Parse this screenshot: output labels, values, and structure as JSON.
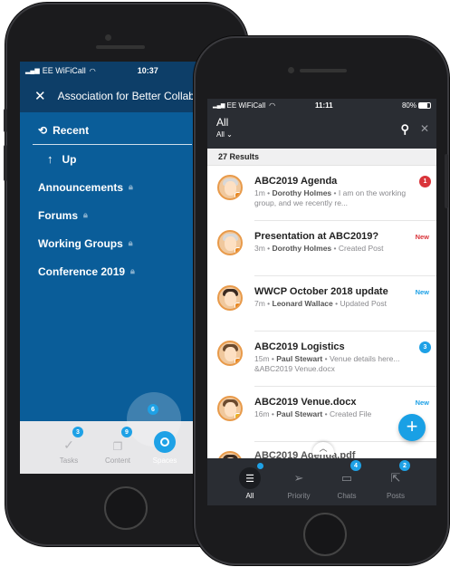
{
  "colors": {
    "accent": "#1ea1e6",
    "back_screen_bg": "#0a5d99",
    "front_header_bg": "#2a2d33",
    "alert_red": "#d9343a"
  },
  "back_phone": {
    "status": {
      "carrier": "EE WiFiCall",
      "time": "10:37"
    },
    "header": {
      "title": "Association for Better Collabo"
    },
    "menu": [
      {
        "label": "Recent",
        "icon": "history-icon"
      },
      {
        "label": "Up",
        "icon": "arrow-up-icon"
      },
      {
        "label": "Announcements",
        "icon": "lock-icon"
      },
      {
        "label": "Forums",
        "icon": "lock-icon"
      },
      {
        "label": "Working Groups",
        "icon": "lock-icon"
      },
      {
        "label": "Conference 2019",
        "icon": "lock-icon"
      }
    ],
    "tabs": [
      {
        "label": "Tasks",
        "badge": "3"
      },
      {
        "label": "Content",
        "badge": "9"
      },
      {
        "label": "Spaces",
        "badge": "6"
      }
    ]
  },
  "front_phone": {
    "status": {
      "carrier": "EE WiFiCall",
      "time": "11:11",
      "battery": "80%"
    },
    "header": {
      "title": "All",
      "filter": "All"
    },
    "results_label": "27 Results",
    "items": [
      {
        "title": "ABC2019 Agenda",
        "time": "1m",
        "author": "Dorothy Holmes",
        "text": "I am on the working group, and we recently re...",
        "marker": "1",
        "marker_color": "#d9343a"
      },
      {
        "title": "Presentation at ABC2019?",
        "time": "3m",
        "author": "Dorothy Holmes",
        "text": "Created Post",
        "marker": "New",
        "marker_color": "#d9343a"
      },
      {
        "title": "WWCP October 2018 update",
        "time": "7m",
        "author": "Leonard Wallace",
        "text": "Updated Post",
        "marker": "New",
        "marker_color": "#1ea1e6"
      },
      {
        "title": "ABC2019 Logistics",
        "time": "15m",
        "author": "Paul Stewart",
        "text": "Venue details here... &ABC2019 Venue.docx",
        "marker": "3",
        "marker_color": "#1ea1e6"
      },
      {
        "title": "ABC2019 Venue.docx",
        "time": "16m",
        "author": "Paul Stewart",
        "text": "Created File",
        "marker": "New",
        "marker_color": "#1ea1e6"
      },
      {
        "title": "ABC2019 Agenda.pdf",
        "time": "",
        "author": "",
        "text": "",
        "marker": "",
        "marker_color": "#1ea1e6"
      }
    ],
    "tabs": [
      {
        "label": "All",
        "badge": ""
      },
      {
        "label": "Priority",
        "badge": ""
      },
      {
        "label": "Chats",
        "badge": "4"
      },
      {
        "label": "Posts",
        "badge": "2"
      }
    ]
  }
}
